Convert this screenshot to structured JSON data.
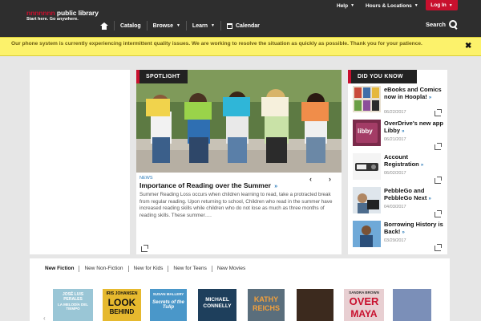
{
  "header": {
    "logo_brand": "nnnnnnn",
    "logo_library": "public library",
    "logo_tagline": "Start here. Go anywhere.",
    "utility": {
      "help": "Help",
      "hours": "Hours & Locations",
      "login": "Log In"
    },
    "nav": [
      {
        "label": "Catalog"
      },
      {
        "label": "Browse"
      },
      {
        "label": "Learn"
      },
      {
        "label": "Calendar"
      }
    ],
    "search_label": "Search"
  },
  "alert": {
    "text": "Our phone system is currently experiencing intermittent quality issues. We are working to resolve the situation as quickly as possible. Thank you for your patience.",
    "close": "✖"
  },
  "spotlight": {
    "tab": "SPOTLIGHT",
    "tag": "NEWS",
    "title": "Importance of Reading over the Summer",
    "body": "Summer Reading Loss occurs when children learning to read, take a protracted break from regular reading. Upon returning to school, Children who read in the summer have increased reading skills while children who do not lose as much as three months of reading skills. These summer…."
  },
  "did_you_know": {
    "tab": "DID YOU KNOW",
    "items": [
      {
        "title": "eBooks and Comics now in Hoopla!",
        "date": "06/22/2017"
      },
      {
        "title": "OverDrive's new app Libby",
        "date": "06/21/2017"
      },
      {
        "title": "Account Registration",
        "date": "06/02/2017"
      },
      {
        "title": "PebbleGo and PebbleGo Next",
        "date": "04/03/2017"
      },
      {
        "title": "Borrowing History is Back!",
        "date": "03/29/2017"
      }
    ],
    "libby_thumb_text": "libby"
  },
  "collections": {
    "tabs": [
      "New Fiction",
      "New Non-Fiction",
      "New for Kids",
      "New for Teens",
      "New Movies"
    ],
    "books": [
      {
        "line1": "JOSÉ LUIS",
        "line2": "PERALES",
        "line3": "LA MELODÍA DEL TIEMPO"
      },
      {
        "line1": "IRIS JOHANSEN",
        "line2": "LOOK",
        "line3": "BEHIND"
      },
      {
        "line1": "SUSAN MALLERY",
        "line2": "Secrets of the Tulip",
        "line3": ""
      },
      {
        "line1": "MICHAEL",
        "line2": "CONNELLY",
        "line3": ""
      },
      {
        "line1": "KATHY",
        "line2": "REICHS",
        "line3": ""
      },
      {
        "line1": "",
        "line2": "",
        "line3": ""
      },
      {
        "line1": "SANDRA BROWN",
        "line2": "OVER",
        "line3": "MAYA"
      },
      {
        "line1": "",
        "line2": "",
        "line3": ""
      }
    ]
  },
  "colors": {
    "header_bg": "#2e2e2e",
    "brand_red": "#c8102e",
    "alert_bg": "#fcf26b",
    "link_blue": "#2a7ab8"
  }
}
